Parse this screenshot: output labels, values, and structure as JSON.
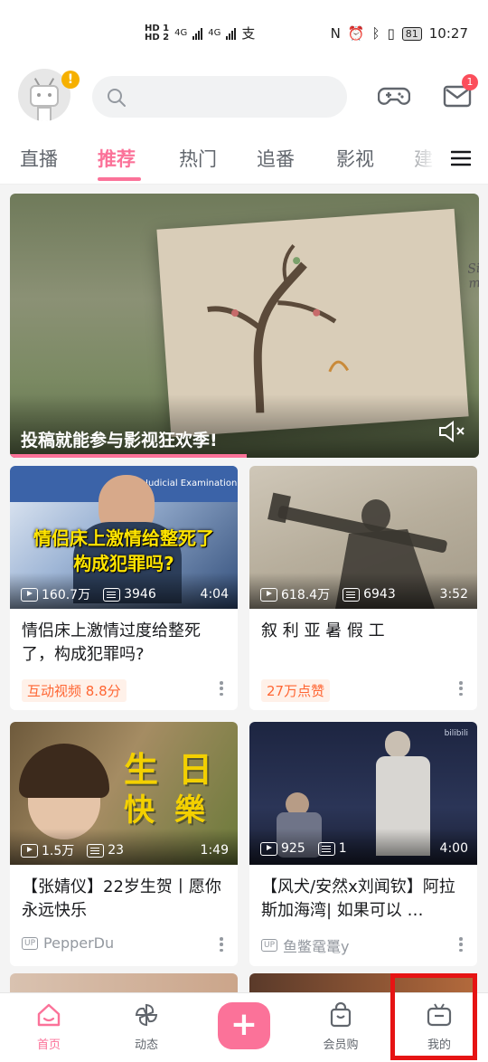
{
  "status_bar": {
    "hd1": "HD 1",
    "hd2": "HD 2",
    "net1": "4G",
    "net2": "4G",
    "battery": "81",
    "time": "10:27"
  },
  "header": {
    "avatar_badge": "!",
    "search_placeholder": "",
    "mail_badge": "1"
  },
  "tabs": [
    "直播",
    "推荐",
    "热门",
    "追番",
    "影视",
    "建"
  ],
  "active_tab_index": 1,
  "banner": {
    "title": "投稿就能参与影视狂欢季!",
    "paper_text": "Sil mmer"
  },
  "cards": [
    {
      "thumb_text_line1": "情侣床上激情给整死了",
      "thumb_text_line2": "构成犯罪吗?",
      "thumb_text_small": "Judicial Examination",
      "views": "160.7万",
      "danmaku": "3946",
      "duration": "4:04",
      "title": "情侣床上激情过度给整死了，构成犯罪吗?",
      "tag": "互动视频 8.8分"
    },
    {
      "views": "618.4万",
      "danmaku": "6943",
      "duration": "3:52",
      "title": "叙 利 亚 暑 假 工",
      "tag": "27万点赞"
    },
    {
      "thumb_text_line1": "生日",
      "thumb_text_line2": "快樂",
      "views": "1.5万",
      "danmaku": "23",
      "duration": "1:49",
      "title": "【张婧仪】22岁生贺丨愿你永远快乐",
      "up_label": "UP",
      "uploader": "PepperDu"
    },
    {
      "thumb_text_small": "bilibili",
      "views": "925",
      "danmaku": "1",
      "duration": "4:00",
      "title": "【风犬/安然x刘闻钦】阿拉斯加海湾| 如果可以 …",
      "up_label": "UP",
      "uploader": "鱼鳖鼋鼍y"
    }
  ],
  "bottom_nav": {
    "home": "首页",
    "dynamic": "动态",
    "plus": "+",
    "shop": "会员购",
    "mine": "我的"
  },
  "colors": {
    "brand_pink": "#fb7299",
    "tag_orange": "#ff6633",
    "highlight_red": "#e61414"
  }
}
